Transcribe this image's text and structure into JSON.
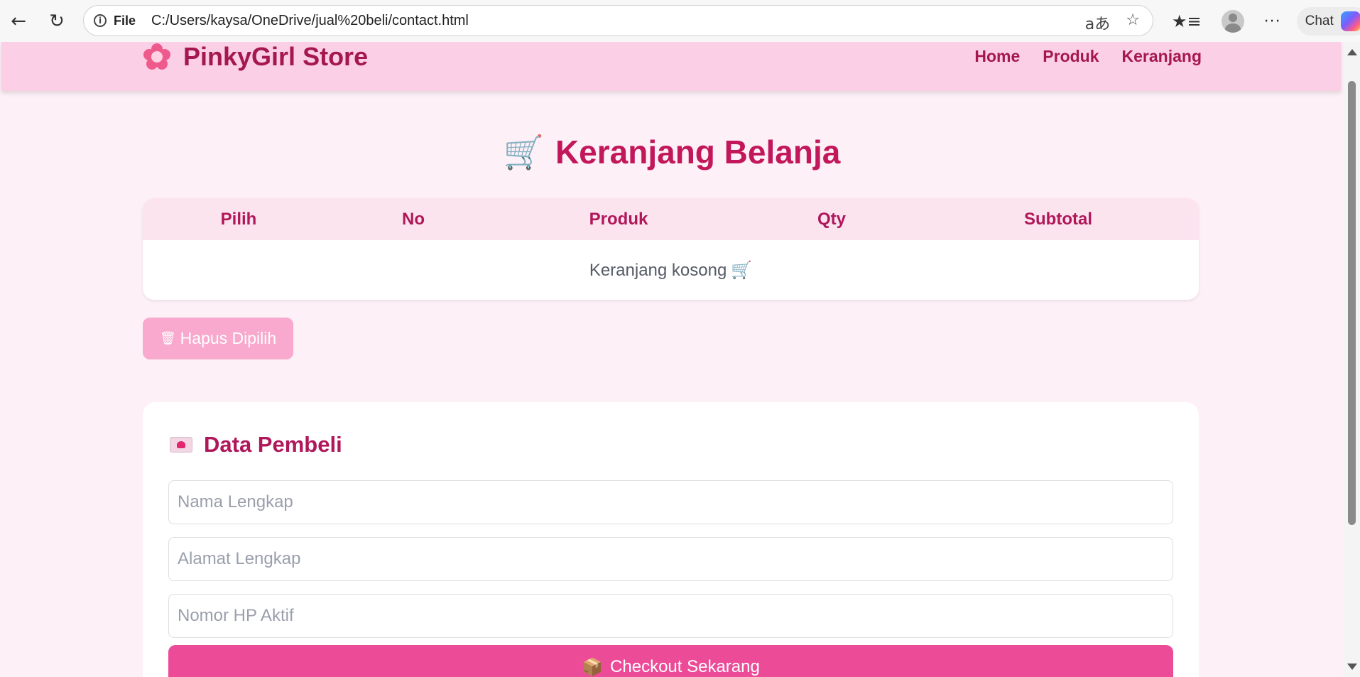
{
  "browser": {
    "back_icon": "back-arrow-icon",
    "reload_icon": "reload-icon",
    "address_label": "File",
    "url": "C:/Users/kaysa/OneDrive/jual%20beli/contact.html",
    "read_aloud_glyph": "aあ",
    "chat_label": "Chat"
  },
  "site": {
    "brand": "PinkyGirl Store",
    "nav": [
      "Home",
      "Produk",
      "Keranjang"
    ],
    "brand_color": "#a5174f",
    "header_bg": "#fbcfe6"
  },
  "cart": {
    "title": "Keranjang Belanja",
    "columns": [
      "Pilih",
      "No",
      "Produk",
      "Qty",
      "Subtotal"
    ],
    "empty_text": "Keranjang kosong",
    "delete_button": "Hapus Dipilih"
  },
  "buyer_form": {
    "title": "Data Pembeli",
    "name_placeholder": "Nama Lengkap",
    "address_placeholder": "Alamat Lengkap",
    "phone_placeholder": "Nomor HP Aktif",
    "checkout_button": "Checkout Sekarang",
    "accent_color": "#ec4b98"
  }
}
